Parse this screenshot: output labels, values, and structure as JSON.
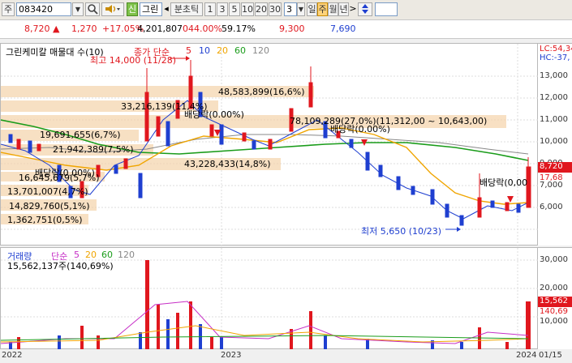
{
  "toolbar": {
    "left_label": "주",
    "stock_code": "083420",
    "search_icon": "search-icon",
    "speaker_icon": "speaker-icon",
    "new_badge": "신",
    "stock_name": "그린",
    "prev_arrow": "◂",
    "mode_label": "분초틱",
    "periods": [
      "1",
      "3",
      "5",
      "10",
      "20",
      "30"
    ],
    "period_value": "3",
    "timeframes": [
      "일",
      "주",
      "월",
      "년"
    ],
    "active_timeframe": "주",
    "next_arrow": ">",
    "updown_icon": "updown-arrows-icon"
  },
  "quote": {
    "price": "8,720",
    "up_arrow": "▲",
    "change": "1,270",
    "change_pct": "+17.05%",
    "volume": "4,201,807",
    "turnover_pct": "044.00%",
    "vol_ratio": "59.17%",
    "high": "9,300",
    "low": "7,690"
  },
  "price_pane": {
    "title": "그린케미칼 매물대 수(10)",
    "ma_label": "종가 단순",
    "ma_periods": [
      "5",
      "10",
      "20",
      "60",
      "120"
    ],
    "top_right_1": "LC:54,34",
    "top_right_2": "HC:-37,",
    "high_annot": "최고 14,000 (11/28)",
    "low_annot": "최저 5,650 (10/23)",
    "dividend_labels": [
      "배당락(0.00%)",
      "배당락(0.00%)",
      "배당락(0.00%)",
      "배당락(0,00"
    ],
    "volume_profile_labels": [
      "48,583,899(16,6%)",
      "33,216,139(11,4%)",
      "78,109,289(27,0%)(11,312,00 ~ 10,643,00)",
      "19,691,655(6,7%)",
      "21,942,389(7,5%)",
      "43,228,433(14,8%)",
      "16,645,679(5,7%)",
      "13,701,007(4,7%)",
      "14,829,760(5,1%)",
      "1,362,751(0,5%)"
    ],
    "current_price_tag": "8,720",
    "prev_tag": "17,68"
  },
  "price_axis": {
    "ticks": [
      "13,000",
      "12,000",
      "11,000",
      "10,000",
      "9,000",
      "7,000",
      "6,000"
    ]
  },
  "vol_pane": {
    "title": "거래량",
    "ma_label": "단순",
    "ma_periods": [
      "5",
      "20",
      "60",
      "120"
    ],
    "subtitle": "15,562,137주(140,69%)",
    "current_tag": "15,562",
    "pct_tag": "140,69"
  },
  "vol_axis": {
    "ticks": [
      "30,000",
      "20,000",
      "10,000"
    ]
  },
  "date_axis": {
    "labels": [
      "2022",
      "2023",
      "2024",
      "01/15"
    ]
  },
  "colors": {
    "up": "#e0171e",
    "down": "#1f3fd0",
    "ma5": "#1f3fd0",
    "ma20": "#f0a500",
    "ma60": "#1a9c1a",
    "ma120": "#888888",
    "profile": "#f5d3aa"
  }
}
